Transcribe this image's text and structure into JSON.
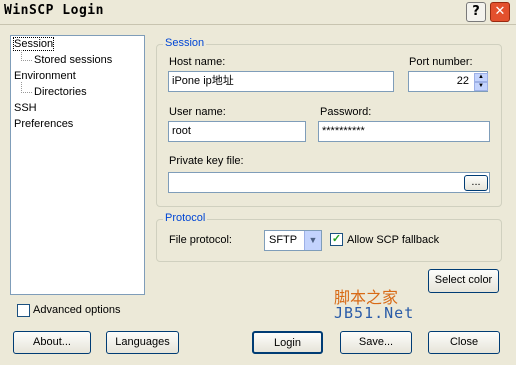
{
  "window": {
    "title": "WinSCP Login",
    "help_label": "?",
    "close_label": "✕"
  },
  "tree": {
    "items": [
      {
        "label": "Session"
      },
      {
        "label": "Stored sessions"
      },
      {
        "label": "Environment"
      },
      {
        "label": "Directories"
      },
      {
        "label": "SSH"
      },
      {
        "label": "Preferences"
      }
    ]
  },
  "session": {
    "group_label": "Session",
    "host_label": "Host name:",
    "host_value": "iPone ip地址",
    "port_label": "Port number:",
    "port_value": "22",
    "user_label": "User name:",
    "user_value": "root",
    "password_label": "Password:",
    "password_value": "**********",
    "keyfile_label": "Private key file:",
    "keyfile_value": "",
    "browse_label": "..."
  },
  "protocol": {
    "group_label": "Protocol",
    "file_protocol_label": "File protocol:",
    "file_protocol_value": "SFTP",
    "allow_scp_label": "Allow SCP fallback",
    "allow_scp_checked": true
  },
  "buttons": {
    "select_color": "Select color",
    "advanced_options": "Advanced options",
    "about": "About...",
    "languages": "Languages",
    "login": "Login",
    "save": "Save...",
    "close": "Close"
  },
  "watermark": {
    "line1": "脚本之家",
    "line2": "JB51.Net"
  }
}
